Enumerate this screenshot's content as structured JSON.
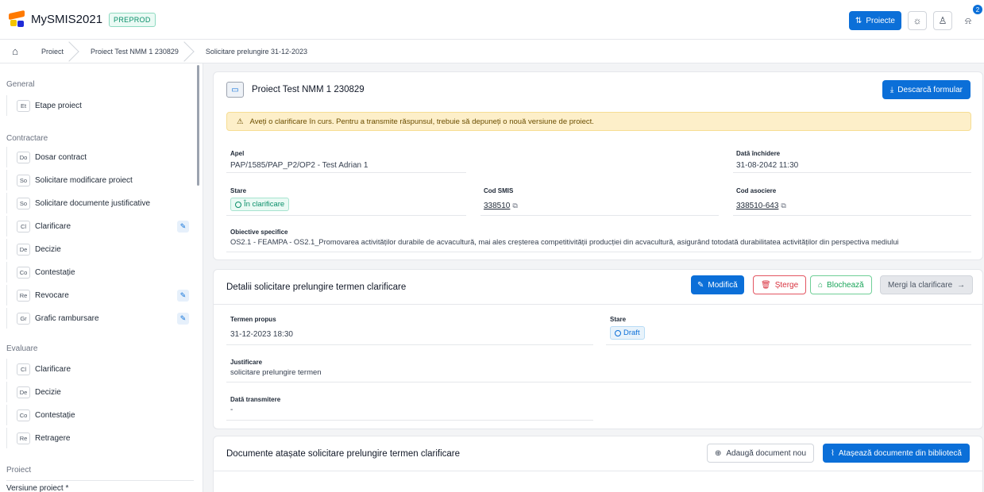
{
  "app": {
    "name": "MySMIS2021",
    "env": "PREPROD"
  },
  "topbar": {
    "projects_label": "Proiecte",
    "notif_count": "2"
  },
  "breadcrumb": {
    "items": [
      "Proiect",
      "Proiect Test NMM 1 230829",
      "Solicitare prelungire 31-12-2023"
    ]
  },
  "sidebar": {
    "sections": {
      "general": "General",
      "contractare": "Contractare",
      "evaluare": "Evaluare",
      "proiect": "Proiect"
    },
    "general_items": [
      {
        "abbr": "Et",
        "label": "Etape proiect"
      }
    ],
    "contractare_items": [
      {
        "abbr": "Do",
        "label": "Dosar contract"
      },
      {
        "abbr": "So",
        "label": "Solicitare modificare proiect"
      },
      {
        "abbr": "So",
        "label": "Solicitare documente justificative"
      },
      {
        "abbr": "Cl",
        "label": "Clarificare"
      },
      {
        "abbr": "De",
        "label": "Decizie"
      },
      {
        "abbr": "Co",
        "label": "Contestație"
      },
      {
        "abbr": "Re",
        "label": "Revocare"
      },
      {
        "abbr": "Gr",
        "label": "Grafic rambursare"
      }
    ],
    "evaluare_items": [
      {
        "abbr": "Cl",
        "label": "Clarificare"
      },
      {
        "abbr": "De",
        "label": "Decizie"
      },
      {
        "abbr": "Co",
        "label": "Contestație"
      },
      {
        "abbr": "Re",
        "label": "Retragere"
      }
    ],
    "proiect_items": [
      {
        "label": "Versiune proiect *"
      }
    ]
  },
  "project_card": {
    "title": "Proiect Test NMM 1 230829",
    "download_label": "Descarcă formular",
    "warning": "Aveți o clarificare în curs. Pentru a transmite răspunsul, trebuie să depuneți o nouă versiune de proiect.",
    "apel_label": "Apel",
    "apel_value": "PAP/1585/PAP_P2/OP2 - Test Adrian 1",
    "data_inchidere_label": "Dată închidere",
    "data_inchidere_value": "31-08-2042 11:30",
    "stare_label": "Stare",
    "stare_value": "În clarificare",
    "cod_smis_label": "Cod SMIS",
    "cod_smis_value": "338510",
    "cod_asociere_label": "Cod asociere",
    "cod_asociere_value": "338510-643",
    "obiective_label": "Obiective specifice",
    "obiective_value": "OS2.1 - FEAMPA - OS2.1_Promovarea activităților durabile de acvacultură, mai ales creșterea competitivității producției din acvacultură, asigurând totodată durabilitatea activităților din perspectiva mediului"
  },
  "details_card": {
    "title": "Detalii solicitare prelungire termen clarificare",
    "modify_label": "Modifică",
    "delete_label": "Șterge",
    "lock_label": "Blochează",
    "goto_label": "Mergi la clarificare",
    "termen_label": "Termen propus",
    "termen_value": "31-12-2023 18:30",
    "stare_label": "Stare",
    "stare_value": "Draft",
    "justificare_label": "Justificare",
    "justificare_value": "solicitare prelungire termen",
    "data_transmitere_label": "Dată transmitere",
    "data_transmitere_value": "-"
  },
  "documents_card": {
    "title": "Documente atașate solicitare prelungire termen clarificare",
    "add_label": "Adaugă document nou",
    "attach_label": "Atașează documente din bibliotecă"
  }
}
